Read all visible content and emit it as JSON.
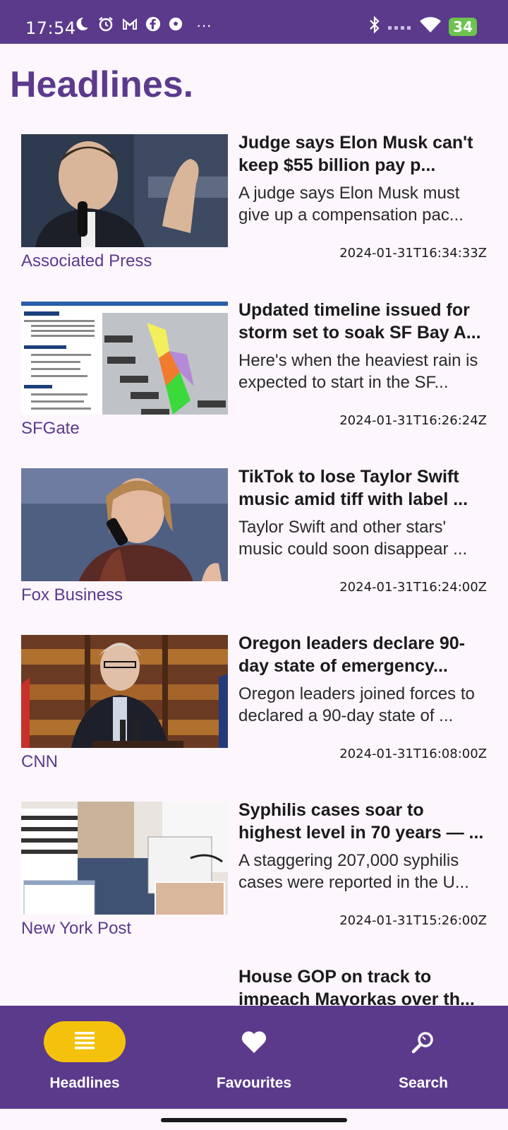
{
  "status_bar": {
    "time": "17:54",
    "battery": "34",
    "overflow": "···"
  },
  "page": {
    "title": "Headlines."
  },
  "articles": [
    {
      "headline": "Judge says Elon Musk can't keep $55 billion pay p...",
      "summary": "A judge says Elon Musk must give up a compensation pac...",
      "source": "Associated Press",
      "timestamp": "2024-01-31T16:34:33Z",
      "image_icon": "elon-musk-photo"
    },
    {
      "headline": "Updated timeline issued for storm set to soak SF Bay A...",
      "summary": "Here's when the heaviest rain is expected to start in the SF...",
      "source": "SFGate",
      "timestamp": "2024-01-31T16:26:24Z",
      "image_icon": "storm-map-image"
    },
    {
      "headline": "TikTok to lose Taylor Swift music amid tiff with label ...",
      "summary": "Taylor Swift and other stars' music could soon disappear ...",
      "source": "Fox Business",
      "timestamp": "2024-01-31T16:24:00Z",
      "image_icon": "taylor-swift-photo"
    },
    {
      "headline": "Oregon leaders declare 90-day state of emergency...",
      "summary": "Oregon leaders joined forces to declared a 90-day state of ...",
      "source": "CNN",
      "timestamp": "2024-01-31T16:08:00Z",
      "image_icon": "oregon-leader-photo"
    },
    {
      "headline": "Syphilis cases soar to highest level in 70 years — ...",
      "summary": "A staggering 207,000 syphilis cases were reported in the U...",
      "source": "New York Post",
      "timestamp": "2024-01-31T15:26:00Z",
      "image_icon": "medical-photo"
    },
    {
      "headline": "House GOP on track to impeach Mayorkas over th...",
      "summary": "",
      "source": "",
      "timestamp": "",
      "image_icon": ""
    }
  ],
  "bottom_nav": {
    "items": [
      {
        "label": "Headlines",
        "icon": "list-icon",
        "active": true
      },
      {
        "label": "Favourites",
        "icon": "heart-icon",
        "active": false
      },
      {
        "label": "Search",
        "icon": "search-icon",
        "active": false
      }
    ]
  },
  "colors": {
    "primary": "#5b3a8c",
    "accent": "#f4c20d",
    "background": "#fdf6fd",
    "battery": "#6cc34f"
  }
}
